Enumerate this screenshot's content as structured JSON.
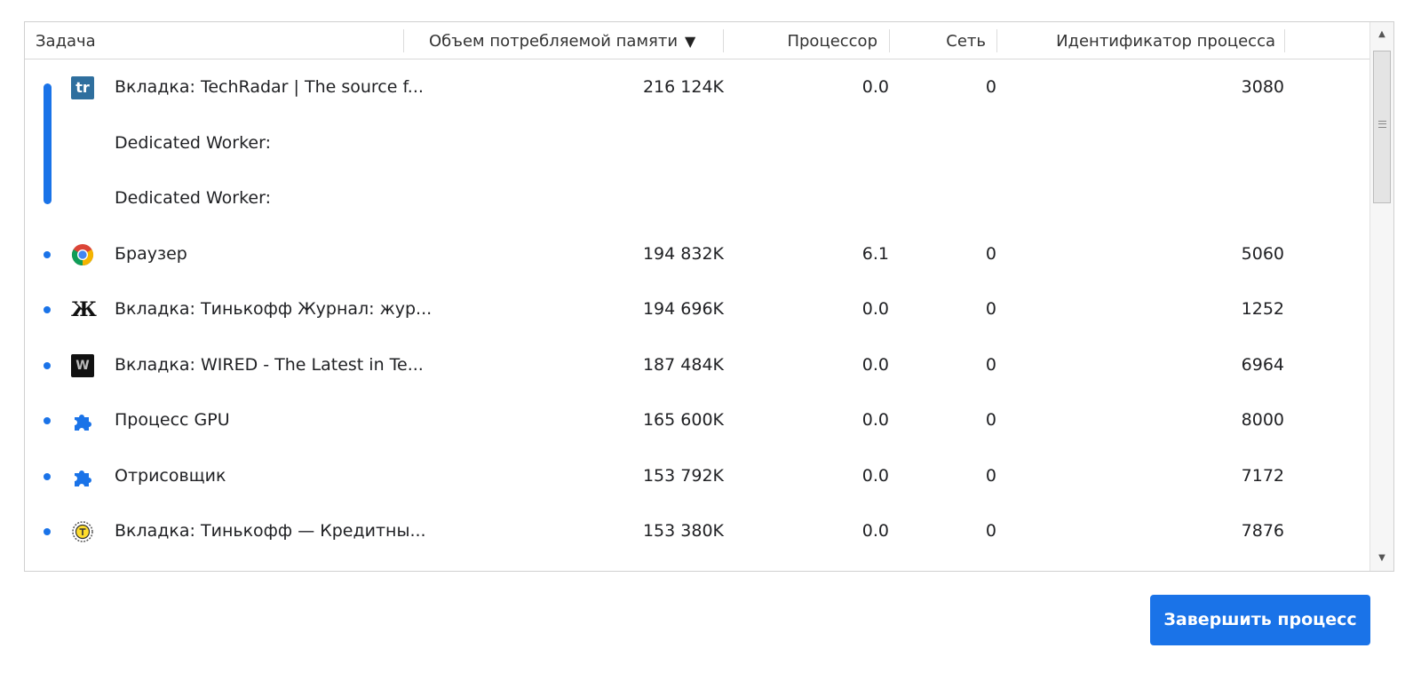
{
  "columns": {
    "task": "Задача",
    "memory": "Объем потребляемой памяти",
    "cpu": "Процессор",
    "network": "Сеть",
    "pid": "Идентификатор процесса"
  },
  "sort": {
    "column": "memory",
    "direction": "descending",
    "indicator": "▼"
  },
  "rows": [
    {
      "icon": "techradar-icon",
      "icon_text": "tr",
      "task": "Вкладка: TechRadar | The source f...",
      "memory": "216 124K",
      "cpu": "0.0",
      "network": "0",
      "pid": "3080"
    },
    {
      "icon": "",
      "task": "Dedicated Worker:",
      "memory": "",
      "cpu": "",
      "network": "",
      "pid": ""
    },
    {
      "icon": "",
      "task": "Dedicated Worker:",
      "memory": "",
      "cpu": "",
      "network": "",
      "pid": ""
    },
    {
      "icon": "chrome-icon",
      "task": "Браузер",
      "memory": "194 832K",
      "cpu": "6.1",
      "network": "0",
      "pid": "5060"
    },
    {
      "icon": "tinkoff-journal-icon",
      "icon_text": "Ж",
      "task": "Вкладка: Тинькофф Журнал: жур...",
      "memory": "194 696K",
      "cpu": "0.0",
      "network": "0",
      "pid": "1252"
    },
    {
      "icon": "wired-icon",
      "icon_text": "W",
      "task": "Вкладка: WIRED - The Latest in Te...",
      "memory": "187 484K",
      "cpu": "0.0",
      "network": "0",
      "pid": "6964"
    },
    {
      "icon": "puzzle-icon",
      "task": "Процесс GPU",
      "memory": "165 600K",
      "cpu": "0.0",
      "network": "0",
      "pid": "8000"
    },
    {
      "icon": "puzzle-icon",
      "task": "Отрисовщик",
      "memory": "153 792K",
      "cpu": "0.0",
      "network": "0",
      "pid": "7172"
    },
    {
      "icon": "tinkoff-bank-icon",
      "task": "Вкладка: Тинькофф — Кредитны...",
      "memory": "153 380K",
      "cpu": "0.0",
      "network": "0",
      "pid": "7876"
    }
  ],
  "actions": {
    "end_process": "Завершить процесс"
  },
  "colors": {
    "accent": "#1a73e8",
    "techradar": "#2f6f9e"
  }
}
